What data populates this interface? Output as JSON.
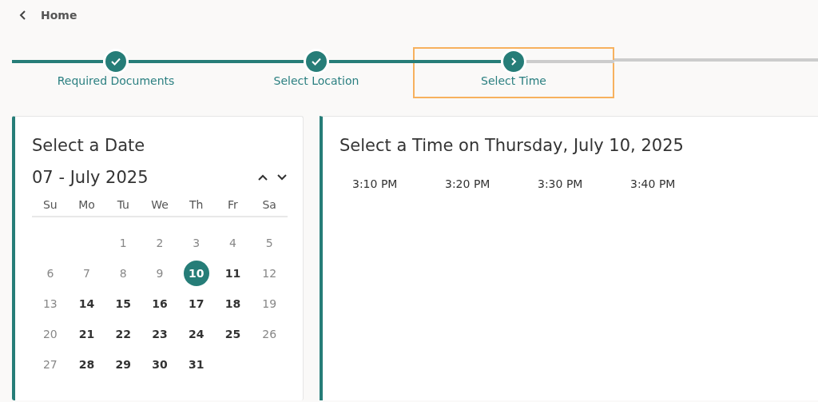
{
  "header": {
    "back_label": "Home"
  },
  "steps": [
    {
      "label": "Required Documents",
      "completed": true,
      "focused": false
    },
    {
      "label": "Select Location",
      "completed": true,
      "focused": false
    },
    {
      "label": "Select Time",
      "completed": false,
      "focused": true
    }
  ],
  "date_panel": {
    "title": "Select a Date",
    "month_label": "07 - July 2025",
    "weekdays": [
      "Su",
      "Mo",
      "Tu",
      "We",
      "Th",
      "Fr",
      "Sa"
    ],
    "days": [
      {
        "kind": "blank"
      },
      {
        "kind": "blank"
      },
      {
        "kind": "day",
        "label": "1",
        "available": false,
        "selected": false
      },
      {
        "kind": "day",
        "label": "2",
        "available": false,
        "selected": false
      },
      {
        "kind": "day",
        "label": "3",
        "available": false,
        "selected": false
      },
      {
        "kind": "day",
        "label": "4",
        "available": false,
        "selected": false
      },
      {
        "kind": "day",
        "label": "5",
        "available": false,
        "selected": false
      },
      {
        "kind": "day",
        "label": "6",
        "available": false,
        "selected": false
      },
      {
        "kind": "day",
        "label": "7",
        "available": false,
        "selected": false
      },
      {
        "kind": "day",
        "label": "8",
        "available": false,
        "selected": false
      },
      {
        "kind": "day",
        "label": "9",
        "available": false,
        "selected": false
      },
      {
        "kind": "day",
        "label": "10",
        "available": true,
        "selected": true
      },
      {
        "kind": "day",
        "label": "11",
        "available": true,
        "selected": false
      },
      {
        "kind": "day",
        "label": "12",
        "available": false,
        "selected": false
      },
      {
        "kind": "day",
        "label": "13",
        "available": false,
        "selected": false
      },
      {
        "kind": "day",
        "label": "14",
        "available": true,
        "selected": false
      },
      {
        "kind": "day",
        "label": "15",
        "available": true,
        "selected": false
      },
      {
        "kind": "day",
        "label": "16",
        "available": true,
        "selected": false
      },
      {
        "kind": "day",
        "label": "17",
        "available": true,
        "selected": false
      },
      {
        "kind": "day",
        "label": "18",
        "available": true,
        "selected": false
      },
      {
        "kind": "day",
        "label": "19",
        "available": false,
        "selected": false
      },
      {
        "kind": "day",
        "label": "20",
        "available": false,
        "selected": false
      },
      {
        "kind": "day",
        "label": "21",
        "available": true,
        "selected": false
      },
      {
        "kind": "day",
        "label": "22",
        "available": true,
        "selected": false
      },
      {
        "kind": "day",
        "label": "23",
        "available": true,
        "selected": false
      },
      {
        "kind": "day",
        "label": "24",
        "available": true,
        "selected": false
      },
      {
        "kind": "day",
        "label": "25",
        "available": true,
        "selected": false
      },
      {
        "kind": "day",
        "label": "26",
        "available": false,
        "selected": false
      },
      {
        "kind": "day",
        "label": "27",
        "available": false,
        "selected": false
      },
      {
        "kind": "day",
        "label": "28",
        "available": true,
        "selected": false
      },
      {
        "kind": "day",
        "label": "29",
        "available": true,
        "selected": false
      },
      {
        "kind": "day",
        "label": "30",
        "available": true,
        "selected": false
      },
      {
        "kind": "day",
        "label": "31",
        "available": true,
        "selected": false
      }
    ]
  },
  "time_panel": {
    "title": "Select a Time on Thursday, July 10, 2025",
    "slots": [
      "3:10 PM",
      "3:20 PM",
      "3:30 PM",
      "3:40 PM"
    ]
  }
}
